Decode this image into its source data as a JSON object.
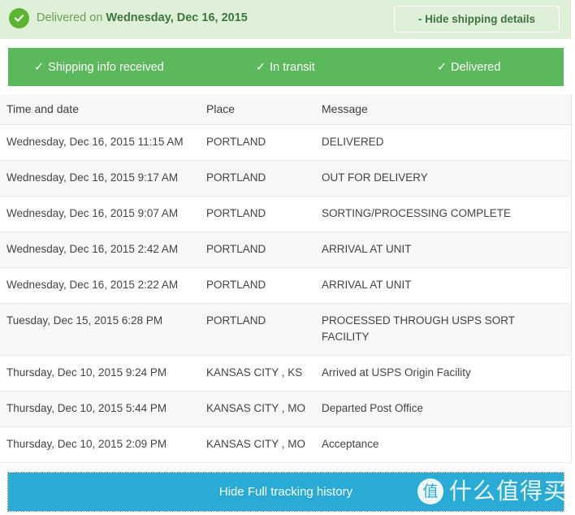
{
  "header": {
    "status_prefix": "Delivered on",
    "status_date": "Wednesday, Dec 16, 2015",
    "check_icon": "check-circle-icon",
    "hide_details_label": "- Hide shipping details"
  },
  "progress": {
    "steps": [
      {
        "label": "Shipping info received",
        "tick": "✓",
        "complete": true
      },
      {
        "label": "In transit",
        "tick": "✓",
        "complete": true
      },
      {
        "label": "Delivered",
        "tick": "✓",
        "complete": true
      }
    ]
  },
  "table": {
    "columns": [
      "Time and date",
      "Place",
      "Message"
    ],
    "rows": [
      {
        "time": "Wednesday, Dec 16, 2015 11:15 AM",
        "place": "PORTLAND",
        "message": "DELIVERED"
      },
      {
        "time": "Wednesday, Dec 16, 2015 9:17 AM",
        "place": "PORTLAND",
        "message": "OUT FOR DELIVERY"
      },
      {
        "time": "Wednesday, Dec 16, 2015 9:07 AM",
        "place": "PORTLAND",
        "message": "SORTING/PROCESSING COMPLETE"
      },
      {
        "time": "Wednesday, Dec 16, 2015 2:42 AM",
        "place": "PORTLAND",
        "message": "ARRIVAL AT UNIT"
      },
      {
        "time": "Wednesday, Dec 16, 2015 2:22 AM",
        "place": "PORTLAND",
        "message": "ARRIVAL AT UNIT"
      },
      {
        "time": "Tuesday, Dec 15, 2015 6:28 PM",
        "place": "PORTLAND",
        "message": "PROCESSED THROUGH USPS SORT FACILITY"
      },
      {
        "time": "Thursday, Dec 10, 2015 9:24 PM",
        "place": "KANSAS CITY , KS",
        "message": "Arrived at USPS Origin Facility"
      },
      {
        "time": "Thursday, Dec 10, 2015 5:44 PM",
        "place": "KANSAS CITY , MO",
        "message": "Departed Post Office"
      },
      {
        "time": "Thursday, Dec 10, 2015 2:09 PM",
        "place": "KANSAS CITY , MO",
        "message": "Acceptance"
      }
    ]
  },
  "footer": {
    "hide_history_label": "Hide Full tracking history",
    "watermark_logo": "值",
    "watermark_text": "什么值得买"
  },
  "colors": {
    "header_bg": "#dff0d8",
    "header_text": "#3c763d",
    "progress_green": "#5cb85c",
    "check_green": "#5cb531",
    "footer_blue": "#29abd6",
    "row_alt_bg": "#f7f7f7"
  }
}
